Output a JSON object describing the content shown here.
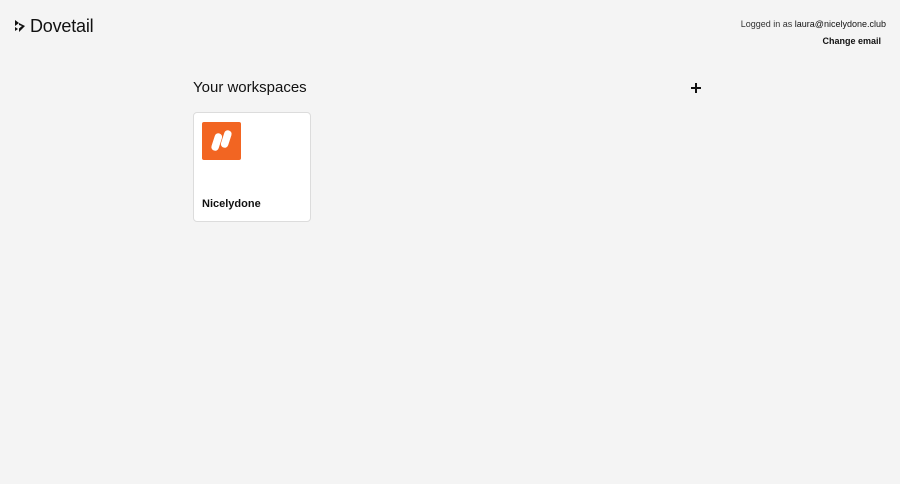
{
  "app": {
    "brand_name": "Dovetail",
    "brand_icon": "dovetail-logo-icon"
  },
  "account": {
    "logged_in_label": "Logged in as ",
    "email": "laura@nicelydone.club",
    "change_email_label": "Change email"
  },
  "workspaces": {
    "title": "Your workspaces",
    "add_icon": "plus-icon",
    "items": [
      {
        "name": "Nicelydone",
        "logo_icon": "nicelydone-logo-icon",
        "logo_color": "#f26522"
      }
    ]
  },
  "colors": {
    "background": "#f4f4f4",
    "card": "#ffffff",
    "text": "#111111"
  }
}
